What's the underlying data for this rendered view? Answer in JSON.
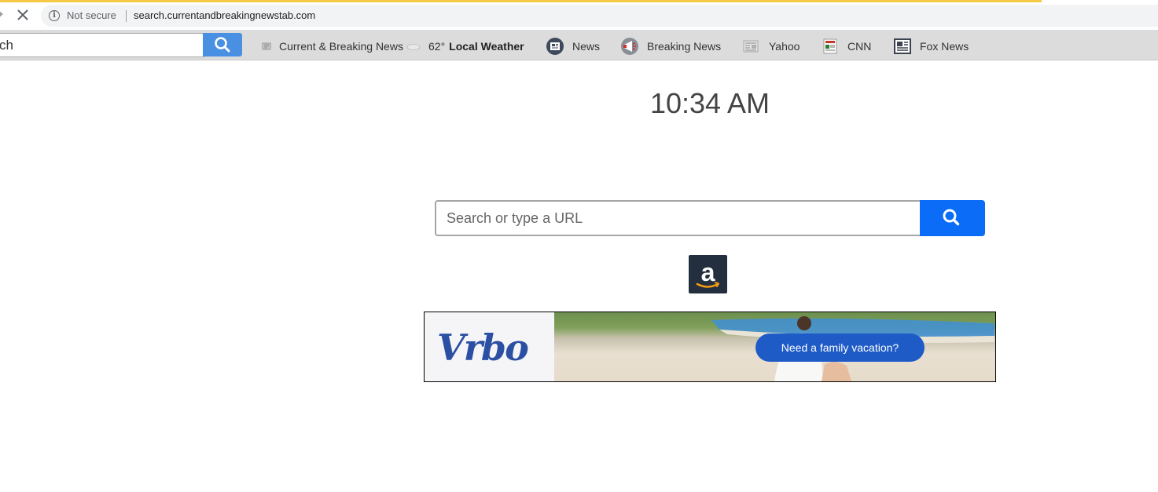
{
  "browser": {
    "security_label": "Not secure",
    "url": "search.currentandbreakingnewstab.com"
  },
  "toolbar": {
    "search_value": "ch",
    "links": [
      {
        "label": "Current & Breaking News",
        "icon": "newspaper-icon"
      },
      {
        "label_prefix": "62°",
        "label": "Local Weather",
        "icon": "cloud-icon"
      },
      {
        "label": "News",
        "icon": "news-circle-icon"
      },
      {
        "label": "Breaking News",
        "icon": "megaphone-icon"
      },
      {
        "label": "Yahoo",
        "icon": "yahoo-newspaper-icon"
      },
      {
        "label": "CNN",
        "icon": "cnn-doc-icon"
      },
      {
        "label": "Fox News",
        "icon": "fox-newspaper-icon"
      }
    ]
  },
  "main": {
    "time": "10:34 AM",
    "search_placeholder": "Search or type a URL",
    "shortcut_icon": "amazon-icon"
  },
  "ad": {
    "brand": "Vrbo",
    "cta": "Need a family vacation?"
  },
  "colors": {
    "accent_blue": "#0a6cf7",
    "toolbar_blue": "#4a90e2",
    "ad_blue": "#1e5bc6",
    "loading_bar": "#f6c944"
  }
}
